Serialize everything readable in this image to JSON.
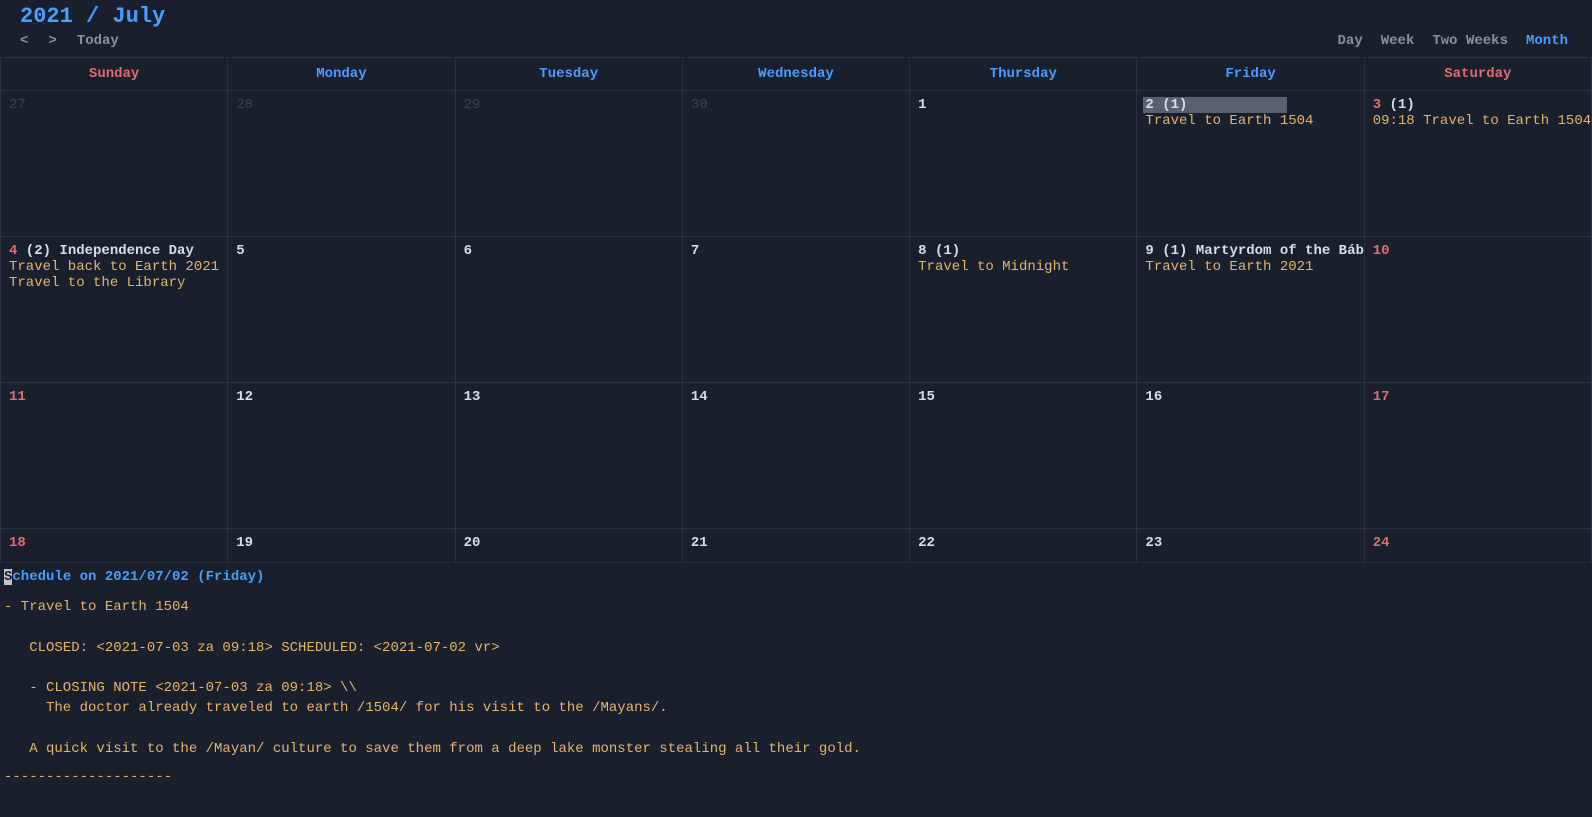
{
  "header": {
    "title": "2021 / July",
    "prev": "<",
    "next": ">",
    "today": "Today",
    "views": [
      "Day",
      "Week",
      "Two Weeks",
      "Month"
    ],
    "active_view": "Month"
  },
  "weekdays": [
    "Sunday",
    "Monday",
    "Tuesday",
    "Wednesday",
    "Thursday",
    "Friday",
    "Saturday"
  ],
  "weeks": [
    {
      "cells": [
        {
          "num": "27",
          "dim": true,
          "weekend": false,
          "count": "",
          "holiday": "",
          "selected": false,
          "events": []
        },
        {
          "num": "28",
          "dim": true,
          "weekend": false,
          "count": "",
          "holiday": "",
          "selected": false,
          "events": []
        },
        {
          "num": "29",
          "dim": true,
          "weekend": false,
          "count": "",
          "holiday": "",
          "selected": false,
          "events": []
        },
        {
          "num": "30",
          "dim": true,
          "weekend": false,
          "count": "",
          "holiday": "",
          "selected": false,
          "events": []
        },
        {
          "num": "1",
          "dim": false,
          "weekend": false,
          "count": "",
          "holiday": "",
          "selected": false,
          "events": []
        },
        {
          "num": "2",
          "dim": false,
          "weekend": false,
          "count": "(1)",
          "holiday": "",
          "selected": true,
          "events": [
            "Travel to Earth 1504"
          ]
        },
        {
          "num": "3",
          "dim": false,
          "weekend": true,
          "count": "(1)",
          "holiday": "",
          "selected": false,
          "events": [
            "09:18 Travel to Earth 1504"
          ]
        }
      ]
    },
    {
      "cells": [
        {
          "num": "4",
          "dim": false,
          "weekend": true,
          "count": "(2)",
          "holiday": "Independence Day",
          "selected": false,
          "events": [
            "Travel back to Earth 2021",
            "Travel to the Library"
          ]
        },
        {
          "num": "5",
          "dim": false,
          "weekend": false,
          "count": "",
          "holiday": "",
          "selected": false,
          "events": []
        },
        {
          "num": "6",
          "dim": false,
          "weekend": false,
          "count": "",
          "holiday": "",
          "selected": false,
          "events": []
        },
        {
          "num": "7",
          "dim": false,
          "weekend": false,
          "count": "",
          "holiday": "",
          "selected": false,
          "events": []
        },
        {
          "num": "8",
          "dim": false,
          "weekend": false,
          "count": "(1)",
          "holiday": "",
          "selected": false,
          "events": [
            "Travel to Midnight"
          ]
        },
        {
          "num": "9",
          "dim": false,
          "weekend": false,
          "count": "(1)",
          "holiday": "Martyrdom of the Báb",
          "selected": false,
          "events": [
            "Travel to Earth 2021"
          ]
        },
        {
          "num": "10",
          "dim": false,
          "weekend": true,
          "count": "",
          "holiday": "",
          "selected": false,
          "events": []
        }
      ]
    },
    {
      "cells": [
        {
          "num": "11",
          "dim": false,
          "weekend": true,
          "count": "",
          "holiday": "",
          "selected": false,
          "events": []
        },
        {
          "num": "12",
          "dim": false,
          "weekend": false,
          "count": "",
          "holiday": "",
          "selected": false,
          "events": []
        },
        {
          "num": "13",
          "dim": false,
          "weekend": false,
          "count": "",
          "holiday": "",
          "selected": false,
          "events": []
        },
        {
          "num": "14",
          "dim": false,
          "weekend": false,
          "count": "",
          "holiday": "",
          "selected": false,
          "events": []
        },
        {
          "num": "15",
          "dim": false,
          "weekend": false,
          "count": "",
          "holiday": "",
          "selected": false,
          "events": []
        },
        {
          "num": "16",
          "dim": false,
          "weekend": false,
          "count": "",
          "holiday": "",
          "selected": false,
          "events": []
        },
        {
          "num": "17",
          "dim": false,
          "weekend": true,
          "count": "",
          "holiday": "",
          "selected": false,
          "events": []
        }
      ]
    },
    {
      "short": true,
      "cells": [
        {
          "num": "18",
          "dim": false,
          "weekend": true,
          "count": "",
          "holiday": "",
          "selected": false,
          "events": []
        },
        {
          "num": "19",
          "dim": false,
          "weekend": false,
          "count": "",
          "holiday": "",
          "selected": false,
          "events": []
        },
        {
          "num": "20",
          "dim": false,
          "weekend": false,
          "count": "",
          "holiday": "",
          "selected": false,
          "events": []
        },
        {
          "num": "21",
          "dim": false,
          "weekend": false,
          "count": "",
          "holiday": "",
          "selected": false,
          "events": []
        },
        {
          "num": "22",
          "dim": false,
          "weekend": false,
          "count": "",
          "holiday": "",
          "selected": false,
          "events": []
        },
        {
          "num": "23",
          "dim": false,
          "weekend": false,
          "count": "",
          "holiday": "",
          "selected": false,
          "events": []
        },
        {
          "num": "24",
          "dim": false,
          "weekend": true,
          "count": "",
          "holiday": "",
          "selected": false,
          "events": []
        }
      ]
    }
  ],
  "detail": {
    "title_prefix": "S",
    "title_rest": "chedule on 2021/07/02 (Friday)",
    "lines": [
      "- Travel to Earth 1504",
      "",
      "   CLOSED: <2021-07-03 za 09:18> SCHEDULED: <2021-07-02 vr>",
      "",
      "   - CLOSING NOTE <2021-07-03 za 09:18> \\\\",
      "     The doctor already traveled to earth /1504/ for his visit to the /Mayans/.",
      "",
      "   A quick visit to the /Mayan/ culture to save them from a deep lake monster stealing all their gold."
    ],
    "hr": "--------------------"
  }
}
